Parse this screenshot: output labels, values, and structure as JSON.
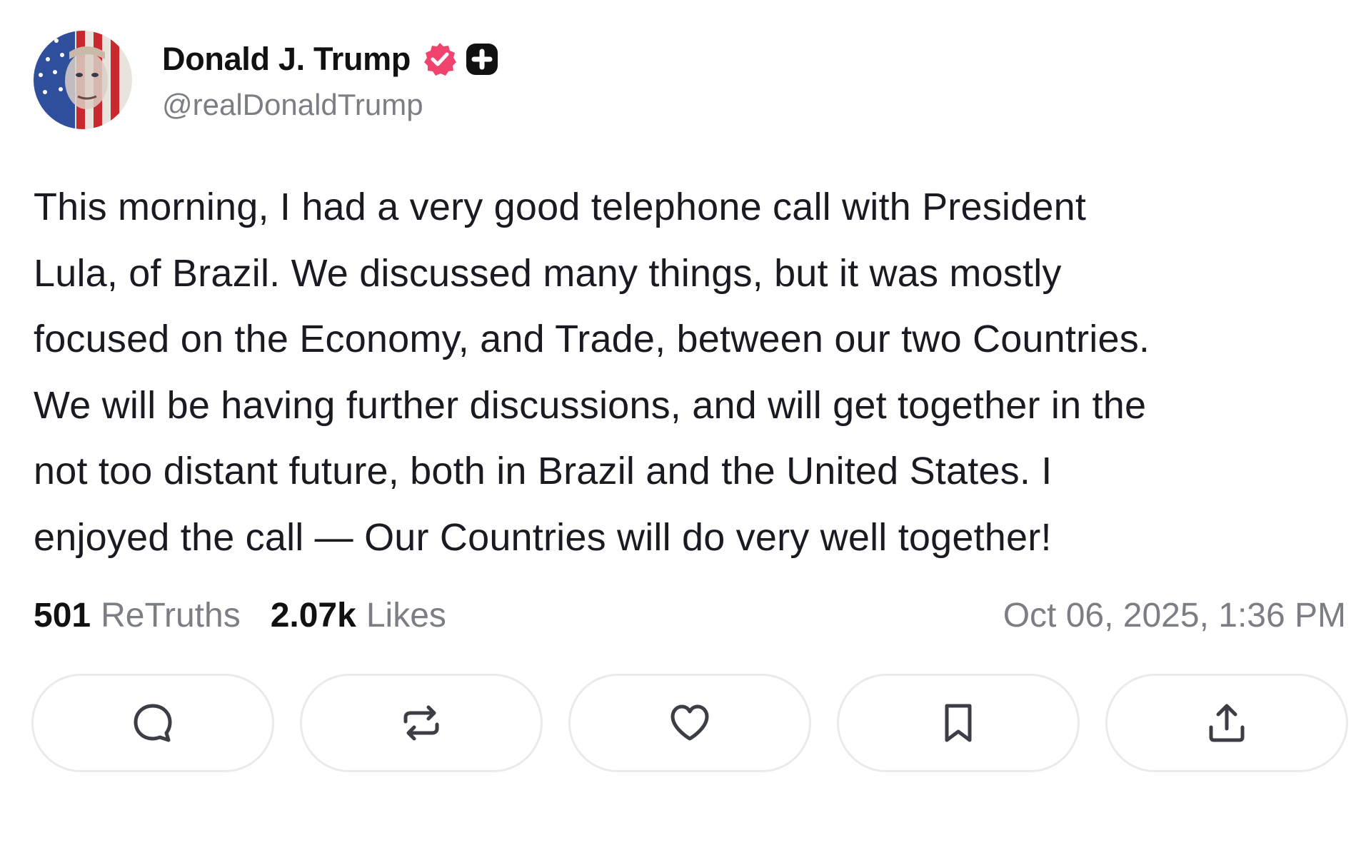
{
  "author": {
    "display_name": "Donald J. Trump",
    "handle": "@realDonaldTrump",
    "avatar_icon": "avatar-flag-portrait",
    "badges": [
      "verified-badge-icon",
      "plus-badge-icon"
    ],
    "verified_color": "#f0446e"
  },
  "post": {
    "text": "This morning, I had a very good telephone call with President\nLula, of Brazil. We discussed many things, but it was mostly\nfocused on the Economy, and Trade, between our two Countries.\nWe will be having further discussions, and will get together in the\nnot too distant future, both in Brazil and the United States. I\nenjoyed the call — Our Countries will do very well together!"
  },
  "stats": {
    "retruths_count": "501",
    "retruths_label": "ReTruths",
    "likes_count": "2.07k",
    "likes_label": "Likes",
    "timestamp": "Oct 06, 2025, 1:36 PM"
  },
  "actions": [
    {
      "name": "reply",
      "icon": "comment-icon"
    },
    {
      "name": "retruth",
      "icon": "repost-icon"
    },
    {
      "name": "like",
      "icon": "heart-icon"
    },
    {
      "name": "bookmark",
      "icon": "bookmark-icon"
    },
    {
      "name": "share",
      "icon": "share-icon"
    }
  ],
  "colors": {
    "text_primary": "#111111",
    "text_secondary": "#7b7f85",
    "button_border": "#eaeaec"
  }
}
